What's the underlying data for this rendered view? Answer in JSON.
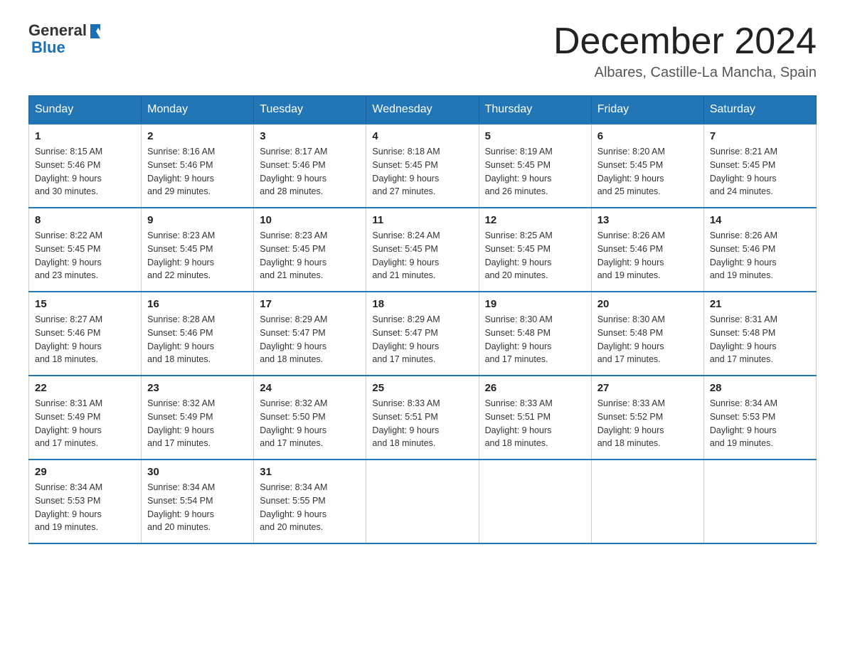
{
  "header": {
    "logo": {
      "part1": "General",
      "part2": "Blue"
    },
    "title": "December 2024",
    "location": "Albares, Castille-La Mancha, Spain"
  },
  "weekdays": [
    "Sunday",
    "Monday",
    "Tuesday",
    "Wednesday",
    "Thursday",
    "Friday",
    "Saturday"
  ],
  "weeks": [
    [
      {
        "day": "1",
        "sunrise": "8:15 AM",
        "sunset": "5:46 PM",
        "daylight": "9 hours and 30 minutes."
      },
      {
        "day": "2",
        "sunrise": "8:16 AM",
        "sunset": "5:46 PM",
        "daylight": "9 hours and 29 minutes."
      },
      {
        "day": "3",
        "sunrise": "8:17 AM",
        "sunset": "5:46 PM",
        "daylight": "9 hours and 28 minutes."
      },
      {
        "day": "4",
        "sunrise": "8:18 AM",
        "sunset": "5:45 PM",
        "daylight": "9 hours and 27 minutes."
      },
      {
        "day": "5",
        "sunrise": "8:19 AM",
        "sunset": "5:45 PM",
        "daylight": "9 hours and 26 minutes."
      },
      {
        "day": "6",
        "sunrise": "8:20 AM",
        "sunset": "5:45 PM",
        "daylight": "9 hours and 25 minutes."
      },
      {
        "day": "7",
        "sunrise": "8:21 AM",
        "sunset": "5:45 PM",
        "daylight": "9 hours and 24 minutes."
      }
    ],
    [
      {
        "day": "8",
        "sunrise": "8:22 AM",
        "sunset": "5:45 PM",
        "daylight": "9 hours and 23 minutes."
      },
      {
        "day": "9",
        "sunrise": "8:23 AM",
        "sunset": "5:45 PM",
        "daylight": "9 hours and 22 minutes."
      },
      {
        "day": "10",
        "sunrise": "8:23 AM",
        "sunset": "5:45 PM",
        "daylight": "9 hours and 21 minutes."
      },
      {
        "day": "11",
        "sunrise": "8:24 AM",
        "sunset": "5:45 PM",
        "daylight": "9 hours and 21 minutes."
      },
      {
        "day": "12",
        "sunrise": "8:25 AM",
        "sunset": "5:45 PM",
        "daylight": "9 hours and 20 minutes."
      },
      {
        "day": "13",
        "sunrise": "8:26 AM",
        "sunset": "5:46 PM",
        "daylight": "9 hours and 19 minutes."
      },
      {
        "day": "14",
        "sunrise": "8:26 AM",
        "sunset": "5:46 PM",
        "daylight": "9 hours and 19 minutes."
      }
    ],
    [
      {
        "day": "15",
        "sunrise": "8:27 AM",
        "sunset": "5:46 PM",
        "daylight": "9 hours and 18 minutes."
      },
      {
        "day": "16",
        "sunrise": "8:28 AM",
        "sunset": "5:46 PM",
        "daylight": "9 hours and 18 minutes."
      },
      {
        "day": "17",
        "sunrise": "8:29 AM",
        "sunset": "5:47 PM",
        "daylight": "9 hours and 18 minutes."
      },
      {
        "day": "18",
        "sunrise": "8:29 AM",
        "sunset": "5:47 PM",
        "daylight": "9 hours and 17 minutes."
      },
      {
        "day": "19",
        "sunrise": "8:30 AM",
        "sunset": "5:48 PM",
        "daylight": "9 hours and 17 minutes."
      },
      {
        "day": "20",
        "sunrise": "8:30 AM",
        "sunset": "5:48 PM",
        "daylight": "9 hours and 17 minutes."
      },
      {
        "day": "21",
        "sunrise": "8:31 AM",
        "sunset": "5:48 PM",
        "daylight": "9 hours and 17 minutes."
      }
    ],
    [
      {
        "day": "22",
        "sunrise": "8:31 AM",
        "sunset": "5:49 PM",
        "daylight": "9 hours and 17 minutes."
      },
      {
        "day": "23",
        "sunrise": "8:32 AM",
        "sunset": "5:49 PM",
        "daylight": "9 hours and 17 minutes."
      },
      {
        "day": "24",
        "sunrise": "8:32 AM",
        "sunset": "5:50 PM",
        "daylight": "9 hours and 17 minutes."
      },
      {
        "day": "25",
        "sunrise": "8:33 AM",
        "sunset": "5:51 PM",
        "daylight": "9 hours and 18 minutes."
      },
      {
        "day": "26",
        "sunrise": "8:33 AM",
        "sunset": "5:51 PM",
        "daylight": "9 hours and 18 minutes."
      },
      {
        "day": "27",
        "sunrise": "8:33 AM",
        "sunset": "5:52 PM",
        "daylight": "9 hours and 18 minutes."
      },
      {
        "day": "28",
        "sunrise": "8:34 AM",
        "sunset": "5:53 PM",
        "daylight": "9 hours and 19 minutes."
      }
    ],
    [
      {
        "day": "29",
        "sunrise": "8:34 AM",
        "sunset": "5:53 PM",
        "daylight": "9 hours and 19 minutes."
      },
      {
        "day": "30",
        "sunrise": "8:34 AM",
        "sunset": "5:54 PM",
        "daylight": "9 hours and 20 minutes."
      },
      {
        "day": "31",
        "sunrise": "8:34 AM",
        "sunset": "5:55 PM",
        "daylight": "9 hours and 20 minutes."
      },
      null,
      null,
      null,
      null
    ]
  ],
  "labels": {
    "sunrise_prefix": "Sunrise: ",
    "sunset_prefix": "Sunset: ",
    "daylight_prefix": "Daylight: "
  }
}
